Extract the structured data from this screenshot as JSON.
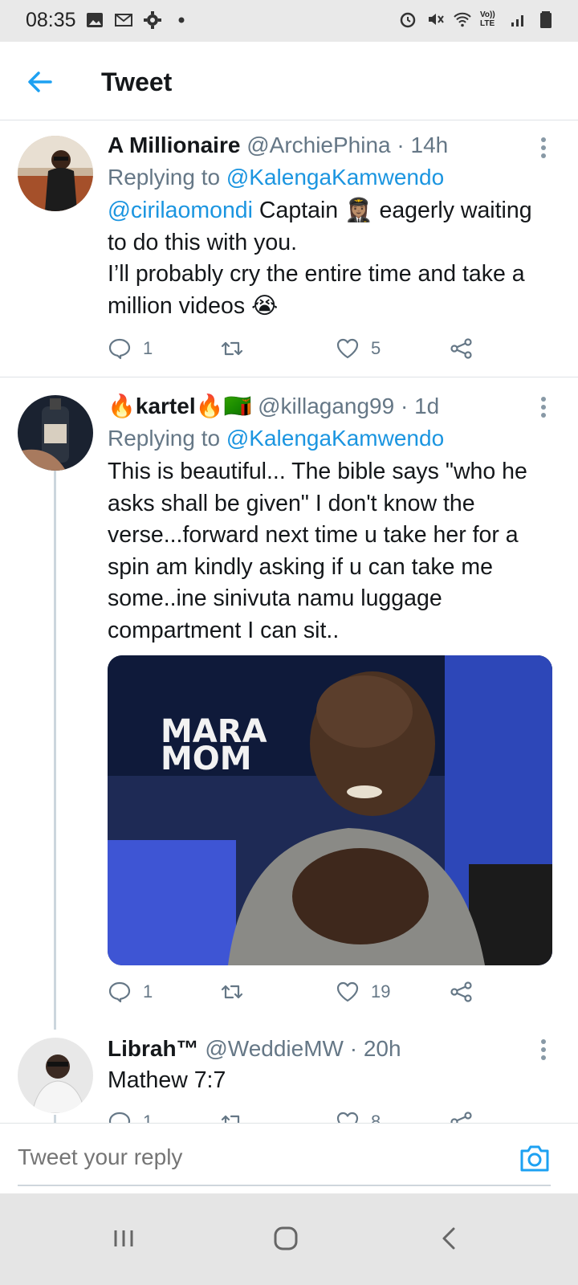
{
  "status_bar": {
    "time": "08:35",
    "left_icons": [
      "gallery-icon",
      "gmail-icon",
      "settings-gear-icon",
      "dot-icon"
    ],
    "right_icons": [
      "alarm-icon",
      "mute-icon",
      "wifi-icon",
      "volte-icon",
      "signal-icon",
      "battery-icon"
    ],
    "volte_label": "Vo)) LTE"
  },
  "header": {
    "title": "Tweet",
    "accent": "#1da1f2"
  },
  "tweets": [
    {
      "name": "A Millionaire",
      "handle": "@ArchiePhina",
      "sep": " · ",
      "time": "14h",
      "replying_prefix": "Replying to ",
      "replying_to": "@KalengaKamwendo",
      "mention_inline": "@cirilaomondi",
      "text_after_mention": " Captain 👩🏽‍✈️ eagerly waiting to do this with you.",
      "text_line2": "I’ll probably cry the entire time and take a million videos 😭",
      "replies": "1",
      "retweets": "",
      "likes": "5"
    },
    {
      "name_emoji_before": "🔥",
      "name": "kartel",
      "name_emoji_after": "🔥🇿🇲",
      "handle": "@killagang99",
      "sep": " · ",
      "time": "1d",
      "replying_prefix": "Replying to ",
      "replying_to": "@KalengaKamwendo",
      "text": "This is beautiful... The bible says \"who he asks shall be given\" I don't know the verse...forward next time u take her for a spin am kindly asking if u can take me some..ine sinivuta namu luggage compartment I can sit..",
      "media_text": "MARA MOM",
      "replies": "1",
      "retweets": "",
      "likes": "19"
    },
    {
      "name": "Librah™",
      "handle": "@WeddieMW",
      "sep": " · ",
      "time": "20h",
      "text": "Mathew 7:7",
      "replies": "1",
      "retweets": "",
      "likes": "8"
    }
  ],
  "composer": {
    "placeholder": "Tweet your reply"
  },
  "nav": [
    "recent-apps-icon",
    "home-icon",
    "back-icon"
  ]
}
